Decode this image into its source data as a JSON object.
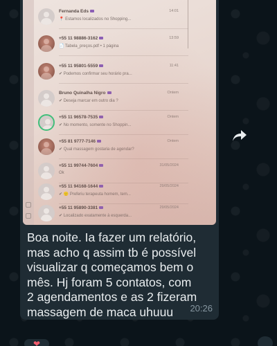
{
  "chat_list": [
    {
      "name": "Fernanda Eds",
      "time": "14:01",
      "preview": "📍 Estamos localizados no Shopping...",
      "avatar": "default"
    },
    {
      "name": "+55 11 98886-3162",
      "time": "13:59",
      "preview": "📄 Tabela_preços.pdf • 1 página",
      "avatar": "photo"
    },
    {
      "name": "+55 11 95801-5559",
      "time": "11:41",
      "preview": "✔ Podemos confirmar seu horário pra...",
      "avatar": "photo"
    },
    {
      "name": "Bruno Quinalha Nigro",
      "time": "Ontem",
      "preview": "✔ Deseja marcar em outro dia ?",
      "avatar": "default"
    },
    {
      "name": "+55 11 96578-7535",
      "time": "Ontem",
      "preview": "✔ No momento, somente no Shoppin...",
      "avatar": "ring"
    },
    {
      "name": "+55 81 9777-7146",
      "time": "Ontem",
      "preview": "✔ Qual massagem gostaria de agendar?",
      "avatar": "photo"
    },
    {
      "name": "+55 11 99744-7604",
      "time": "31/05/2024",
      "preview": "Ok",
      "avatar": "default"
    },
    {
      "name": "+55 11 94168-1644",
      "time": "29/05/2024",
      "preview": "✔ 🙂 Preferiu terapeuta homem, tem...",
      "avatar": "default"
    },
    {
      "name": "+55 11 95890-3381",
      "time": "29/05/2024",
      "preview": "✔ Localizado exatamente à esquerda...",
      "avatar": "default"
    }
  ],
  "message": {
    "text": "Boa noite. Ia fazer um relatório,\nmas acho q assim tb é possível\nvisualizar q começamos bem o\nmês.  Hj foram  5 contatos, com\n2 agendamentos e as 2 fizeram\nmassagem de maca uhuuu",
    "time": "20:26"
  },
  "reaction": "❤",
  "icons": {
    "forward": "forward-icon",
    "heart": "heart-icon"
  },
  "colors": {
    "background": "#0b141a",
    "bubble": "#1f2c34",
    "text": "#e9edef",
    "time": "#8696a0"
  }
}
